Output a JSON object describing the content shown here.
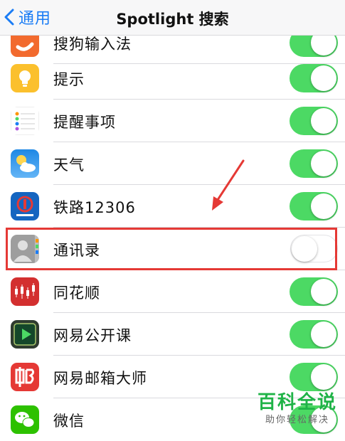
{
  "navbar": {
    "back_label": "通用",
    "title": "Spotlight 搜索"
  },
  "rows": [
    {
      "label": "搜狗输入法",
      "enabled": true,
      "icon": "sogou-input-icon"
    },
    {
      "label": "提示",
      "enabled": true,
      "icon": "tips-lightbulb-icon"
    },
    {
      "label": "提醒事项",
      "enabled": true,
      "icon": "reminders-icon"
    },
    {
      "label": "天气",
      "enabled": true,
      "icon": "weather-icon"
    },
    {
      "label": "铁路12306",
      "enabled": true,
      "icon": "railway-12306-icon"
    },
    {
      "label": "通讯录",
      "enabled": false,
      "icon": "contacts-icon"
    },
    {
      "label": "同花顺",
      "enabled": true,
      "icon": "tonghuashun-icon"
    },
    {
      "label": "网易公开课",
      "enabled": true,
      "icon": "netease-open-course-icon"
    },
    {
      "label": "网易邮箱大师",
      "enabled": true,
      "icon": "netease-mail-master-icon"
    },
    {
      "label": "微信",
      "enabled": true,
      "icon": "wechat-icon"
    }
  ],
  "watermark": {
    "title": "百科全说",
    "subtitle": "助你轻松解决"
  },
  "colors": {
    "accent": "#1a7cf5",
    "toggle_on": "#4cd964",
    "highlight": "#e53935",
    "watermark": "#1fb347"
  }
}
